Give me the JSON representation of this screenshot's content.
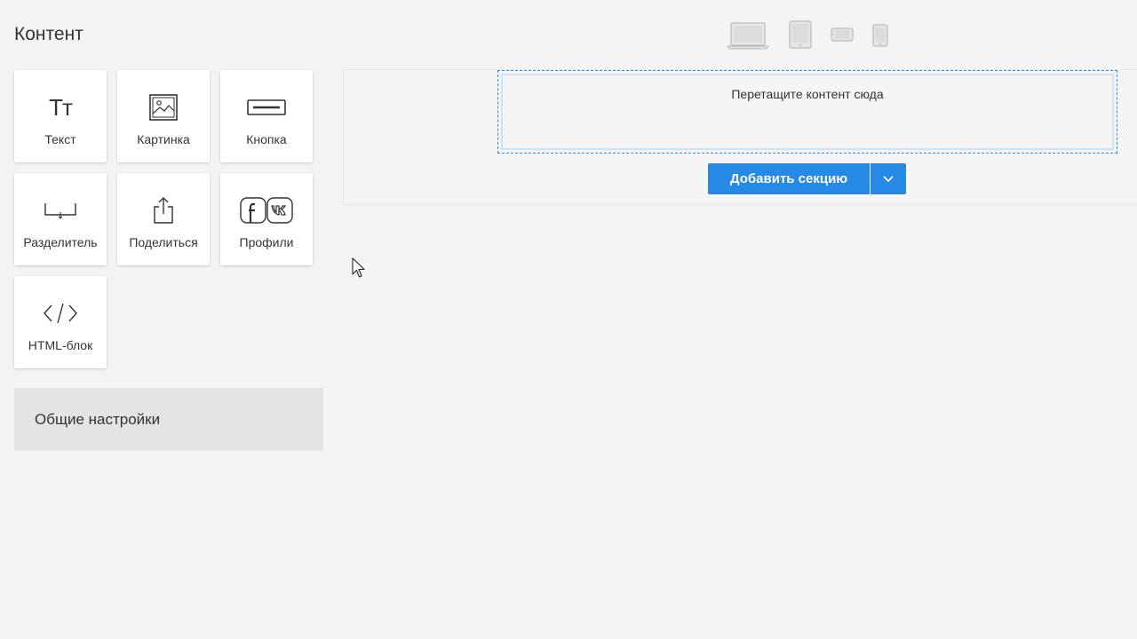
{
  "sidebar": {
    "title": "Контент",
    "blocks": [
      {
        "label": "Текст",
        "icon": "text-icon",
        "glyph": "Tт"
      },
      {
        "label": "Картинка",
        "icon": "image-icon"
      },
      {
        "label": "Кнопка",
        "icon": "button-icon"
      },
      {
        "label": "Разделитель",
        "icon": "divider-icon"
      },
      {
        "label": "Поделиться",
        "icon": "share-icon"
      },
      {
        "label": "Профили",
        "icon": "social-profiles-icon"
      },
      {
        "label": "HTML-блок",
        "icon": "code-icon"
      }
    ],
    "settings_label": "Общие настройки"
  },
  "devices": [
    "desktop-icon",
    "tablet-icon",
    "tablet-landscape-icon",
    "mobile-icon"
  ],
  "canvas": {
    "dropzone_text": "Перетащите контент сюда",
    "add_section_label": "Добавить секцию"
  },
  "colors": {
    "accent": "#2689e4",
    "background": "#f4f4f4",
    "settings_bg": "#e4e4e4"
  }
}
